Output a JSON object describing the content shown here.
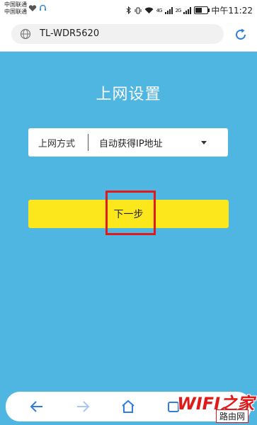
{
  "statusbar": {
    "carrier_line1": "中国联通",
    "carrier_line2": "中国联通",
    "network_1": "4G",
    "network_2": "2G",
    "time": "中午11:22"
  },
  "browser": {
    "url": "TL-WDR5620"
  },
  "page": {
    "title": "上网设置",
    "connection": {
      "label": "上网方式",
      "value": "自动获得IP地址"
    },
    "next_label": "下一步"
  },
  "watermark": {
    "main": "WIFI之家",
    "sub": "路由网"
  },
  "colors": {
    "background": "#4fb6e2",
    "button": "#fbe71c",
    "highlight": "#e01a1a"
  }
}
